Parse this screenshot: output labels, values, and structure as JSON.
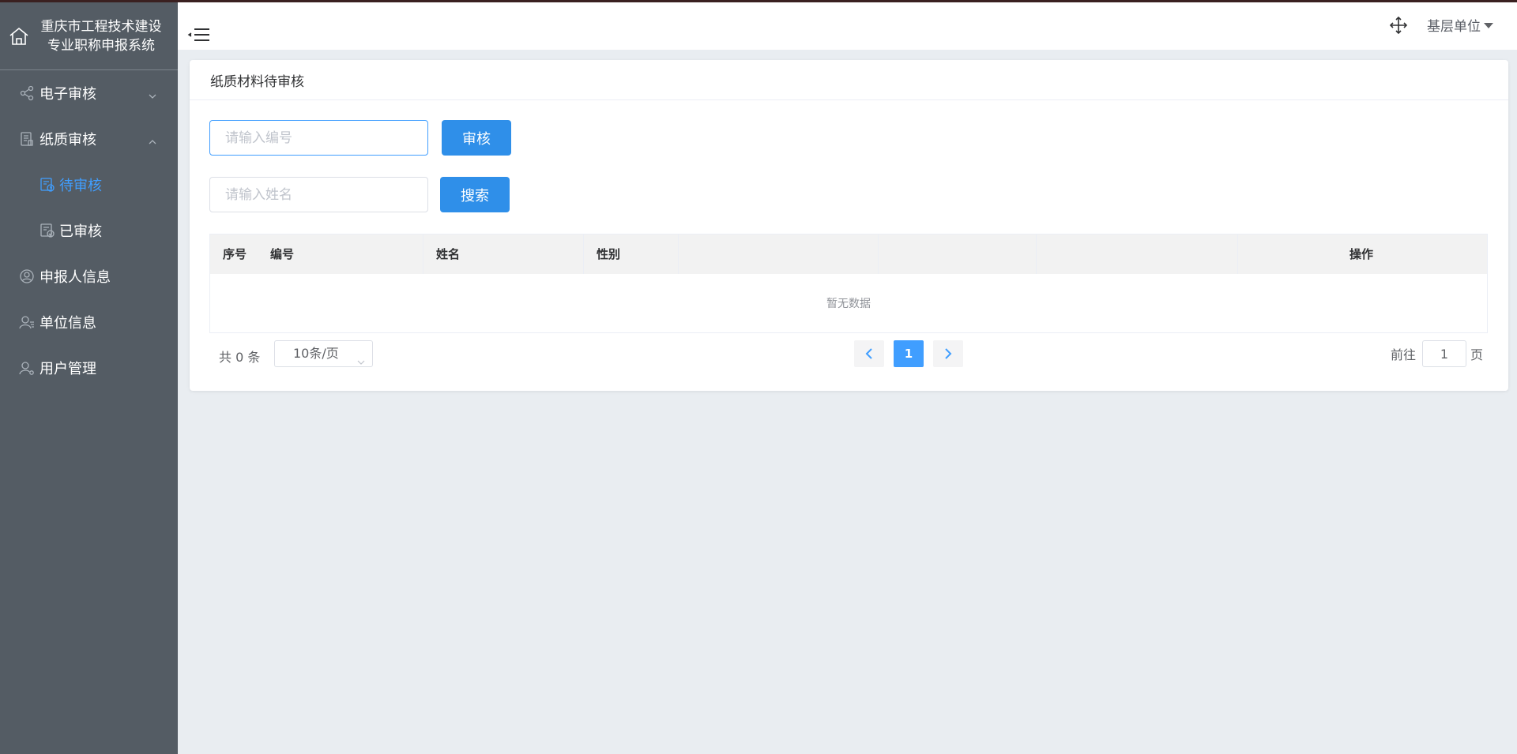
{
  "app": {
    "title": "重庆市工程技术建设专业职称申报系统"
  },
  "sidebar": {
    "items": [
      {
        "label": "电子审核",
        "icon": "share-nodes-icon",
        "expanded": false
      },
      {
        "label": "纸质审核",
        "icon": "document-icon",
        "expanded": true
      },
      {
        "label": "申报人信息",
        "icon": "user-circle-icon"
      },
      {
        "label": "单位信息",
        "icon": "user-list-icon"
      },
      {
        "label": "用户管理",
        "icon": "user-gear-icon"
      }
    ],
    "subitems": [
      {
        "label": "待审核",
        "icon": "pending-doc-icon",
        "active": true
      },
      {
        "label": "已审核",
        "icon": "checked-doc-icon",
        "active": false
      }
    ]
  },
  "header": {
    "user_label": "基层单位"
  },
  "card": {
    "title": "纸质材料待审核"
  },
  "search": {
    "code_placeholder": "请输入编号",
    "review_button": "审核",
    "name_placeholder": "请输入姓名",
    "search_button": "搜索"
  },
  "table": {
    "columns": [
      "序号",
      "编号",
      "姓名",
      "性别",
      "操作"
    ],
    "empty_text": "暂无数据"
  },
  "pagination": {
    "total_text": "共 0 条",
    "page_size": "10条/页",
    "current_page": "1",
    "goto_label": "前往",
    "goto_value": "1",
    "page_suffix": "页"
  },
  "colors": {
    "sidebar_bg": "#545c64",
    "active": "#409eff",
    "button": "#2f8fe9"
  }
}
